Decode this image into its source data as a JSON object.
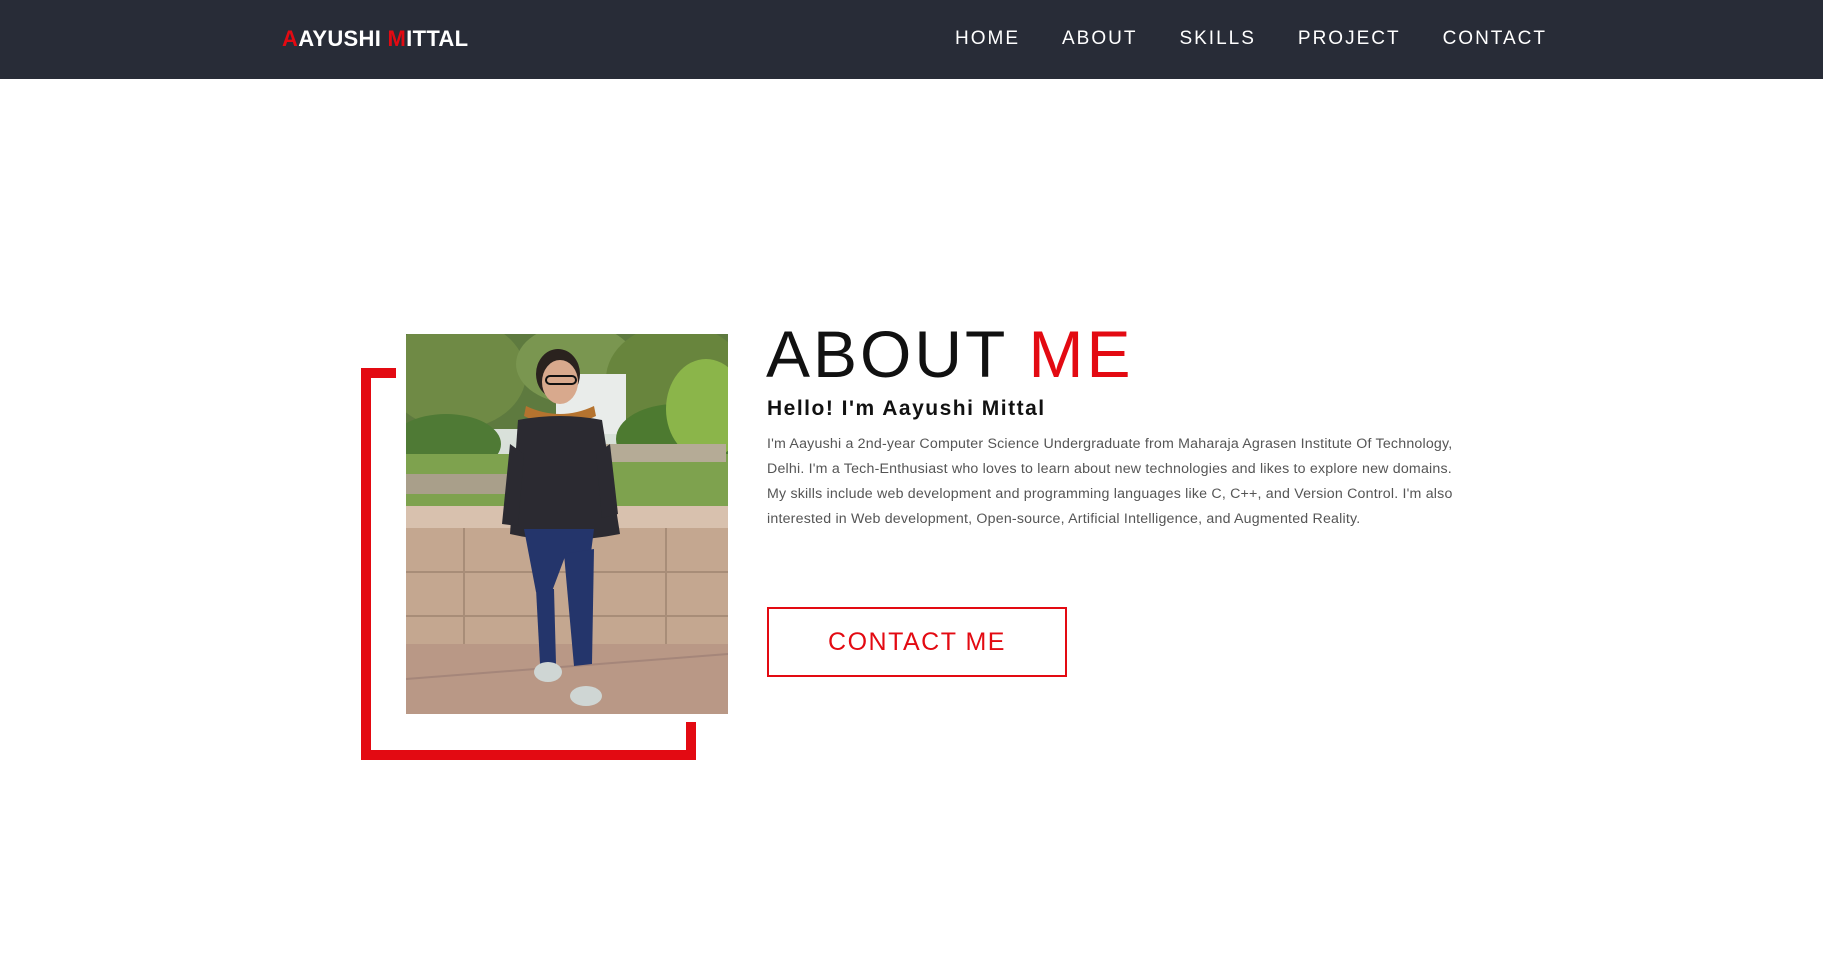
{
  "header": {
    "logo_first_initial": "A",
    "logo_first_rest": "AYUSHI ",
    "logo_last_initial": "M",
    "logo_last_rest": "ITTAL",
    "nav": [
      {
        "label": "HOME"
      },
      {
        "label": "ABOUT"
      },
      {
        "label": "SKILLS"
      },
      {
        "label": "PROJECT"
      },
      {
        "label": "CONTACT"
      }
    ]
  },
  "about": {
    "heading_plain": "ABOUT ",
    "heading_accent": "ME",
    "greeting": "Hello! I'm Aayushi Mittal",
    "bio": "I'm Aayushi a 2nd-year Computer Science Undergraduate from Maharaja Agrasen Institute Of Technology, Delhi. I'm a Tech-Enthusiast who loves to learn about new technologies and likes to explore new domains. My skills include web development and programming languages like C, C++, and Version Control. I'm also interested in Web development, Open-source, Artificial Intelligence, and Augmented Reality.",
    "cta_label": "CONTACT ME"
  },
  "colors": {
    "accent": "#e30a12",
    "navbar_bg": "#282c37",
    "background": "#ffffff"
  }
}
